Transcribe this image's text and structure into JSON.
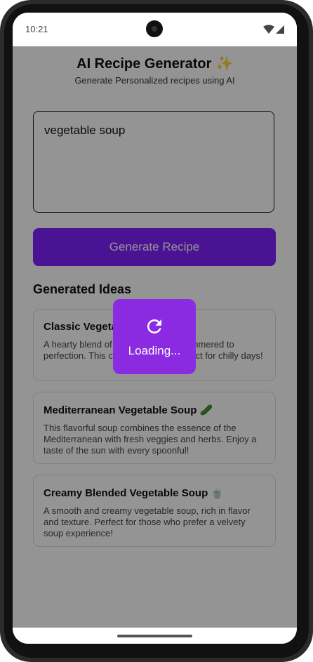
{
  "status_bar": {
    "time": "10:21"
  },
  "header": {
    "title": "AI Recipe Generator ✨",
    "subtitle": "Generate Personalized recipes using AI"
  },
  "prompt": {
    "value": "vegetable soup"
  },
  "generate_button": {
    "label": "Generate Recipe"
  },
  "ideas": {
    "heading": "Generated Ideas",
    "items": [
      {
        "title": "Classic Vegetable Soup",
        "description": "A hearty blend of fresh vegetables simmered to perfection. This classic recipe is perfect for chilly days!"
      },
      {
        "title": "Mediterranean Vegetable Soup 🥒",
        "description": "This flavorful soup combines the essence of the Mediterranean with fresh veggies and herbs. Enjoy a taste of the sun with every spoonful!"
      },
      {
        "title": "Creamy Blended Vegetable Soup 🍵",
        "description": "A smooth and creamy vegetable soup, rich in flavor and texture. Perfect for those who prefer a velvety soup experience!"
      }
    ]
  },
  "loading": {
    "label": "Loading...",
    "icon": "refresh-icon"
  },
  "colors": {
    "primary": "#7f22fe",
    "loader": "#8a2be2",
    "overlay": "rgba(0,0,0,0.42)"
  }
}
